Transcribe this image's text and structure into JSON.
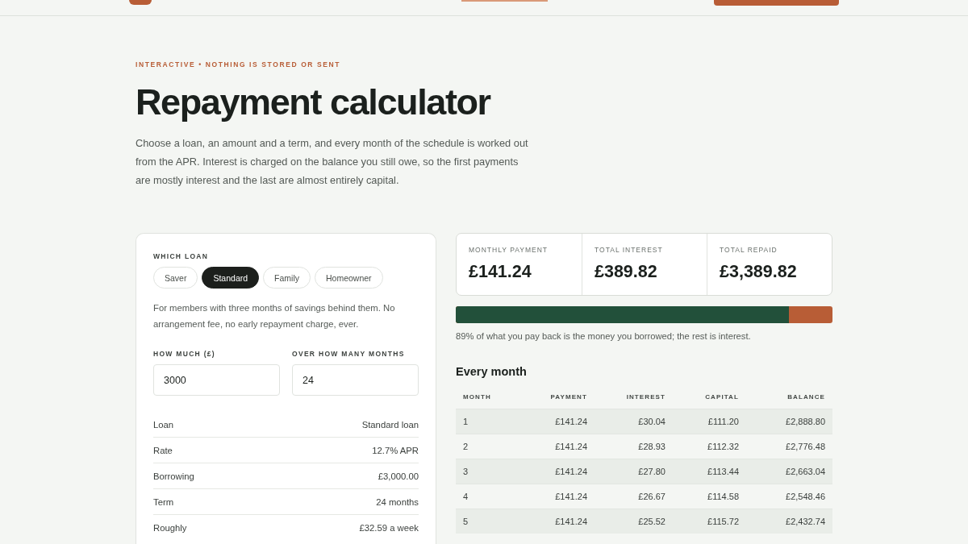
{
  "eyebrow": "INTERACTIVE • NOTHING IS STORED OR SENT",
  "title": "Repayment calculator",
  "intro": "Choose a loan, an amount and a term, and every month of the schedule is worked out from the APR. Interest is charged on the balance you still owe, so the first payments are mostly interest and the last are almost entirely capital.",
  "loan_picker": {
    "label": "WHICH LOAN",
    "options": [
      {
        "label": "Saver",
        "selected": false
      },
      {
        "label": "Standard",
        "selected": true
      },
      {
        "label": "Family",
        "selected": false
      },
      {
        "label": "Homeowner",
        "selected": false
      }
    ],
    "description": "For members with three months of savings behind them. No arrangement fee, no early repayment charge, ever."
  },
  "fields": [
    {
      "label": "HOW MUCH (£)",
      "value": "3000"
    },
    {
      "label": "OVER HOW MANY MONTHS",
      "value": "24"
    }
  ],
  "summary": [
    {
      "label": "Loan",
      "value": "Standard loan"
    },
    {
      "label": "Rate",
      "value": "12.7% APR"
    },
    {
      "label": "Borrowing",
      "value": "£3,000.00"
    },
    {
      "label": "Term",
      "value": "24 months"
    },
    {
      "label": "Roughly",
      "value": "£32.59 a week"
    }
  ],
  "stats": [
    {
      "label": "MONTHLY PAYMENT",
      "value": "£141.24"
    },
    {
      "label": "TOTAL INTEREST",
      "value": "£389.82"
    },
    {
      "label": "TOTAL REPAID",
      "value": "£3,389.82"
    }
  ],
  "split_bar": {
    "level": 0.885,
    "caption": "89% of what you pay back is the money you borrowed; the rest is interest."
  },
  "schedule": {
    "title": "Every month",
    "columns": [
      "MONTH",
      "PAYMENT",
      "INTEREST",
      "CAPITAL",
      "BALANCE"
    ],
    "rows": [
      [
        "1",
        "£141.24",
        "£30.04",
        "£111.20",
        "£2,888.80"
      ],
      [
        "2",
        "£141.24",
        "£28.93",
        "£112.32",
        "£2,776.48"
      ],
      [
        "3",
        "£141.24",
        "£27.80",
        "£113.44",
        "£2,663.04"
      ],
      [
        "4",
        "£141.24",
        "£26.67",
        "£114.58",
        "£2,548.46"
      ],
      [
        "5",
        "£141.24",
        "£25.52",
        "£115.72",
        "£2,432.74"
      ]
    ]
  }
}
